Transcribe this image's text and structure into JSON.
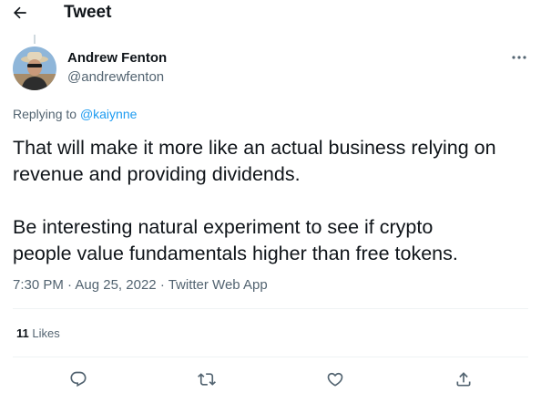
{
  "header": {
    "title": "Tweet",
    "back_icon": "arrow-left-icon"
  },
  "tweet": {
    "author_name": "Andrew Fenton",
    "author_handle": "@andrewfenton",
    "replying_prefix": "Replying to",
    "replying_to": "@kaiynne",
    "paragraphs": [
      [
        "That will make it more like an actual business relying on",
        "revenue and providing dividends."
      ],
      [
        "Be interesting natural experiment to see if crypto",
        "people value fundamentals higher than free tokens."
      ]
    ],
    "time": "7:30 PM",
    "date": "Aug 25, 2022",
    "source": "Twitter Web App",
    "separator": "·",
    "likes_count": "11",
    "likes_label": "Likes"
  },
  "actions": [
    "reply-icon",
    "retweet-icon",
    "like-icon",
    "share-icon"
  ],
  "colors": {
    "text": "#0f1419",
    "secondary": "#536471",
    "accent": "#1d9bf0",
    "divider": "#eff3f4"
  }
}
